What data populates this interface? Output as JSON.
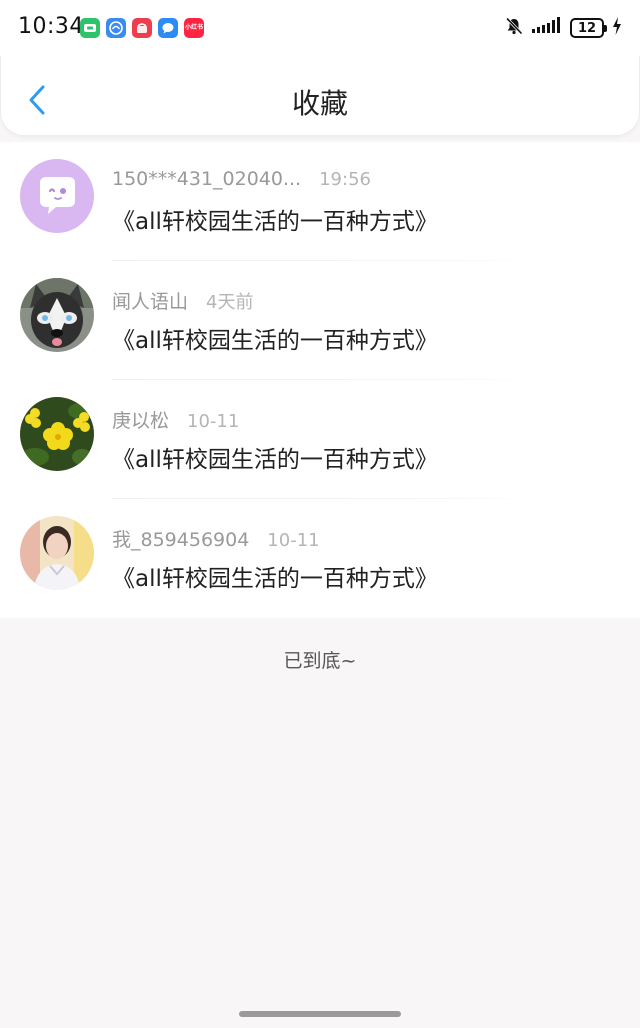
{
  "status_bar": {
    "time": "10:34",
    "battery": "12",
    "app_icons": [
      {
        "name": "video-app-icon",
        "color": "#2cc36b",
        "label": ""
      },
      {
        "name": "browser-app-icon",
        "color": "#3a8bf0",
        "label": ""
      },
      {
        "name": "app-gallery-icon",
        "color": "#ee3d4d",
        "label": ""
      },
      {
        "name": "message-app-icon",
        "color": "#2c8cf4",
        "label": ""
      },
      {
        "name": "xiaohongshu-app-icon",
        "color": "#ff2442",
        "label": "小红书"
      }
    ]
  },
  "header": {
    "title": "收藏",
    "accent_color": "#2d9cf0"
  },
  "favorites": [
    {
      "avatar": "chat-bubble-avatar",
      "username": "150***431_02040...",
      "time": "19:56",
      "title": "《all轩校园生活的一百种方式》"
    },
    {
      "avatar": "husky-dog-avatar",
      "username": "闻人语山",
      "time": "4天前",
      "title": "《all轩校园生活的一百种方式》"
    },
    {
      "avatar": "yellow-flower-avatar",
      "username": "庚以松",
      "time": "10-11",
      "title": "《all轩校园生活的一百种方式》"
    },
    {
      "avatar": "person-photo-avatar",
      "username": "我_859456904",
      "time": "10-11",
      "title": "《all轩校园生活的一百种方式》"
    }
  ],
  "footer": {
    "end_text": "已到底~"
  }
}
